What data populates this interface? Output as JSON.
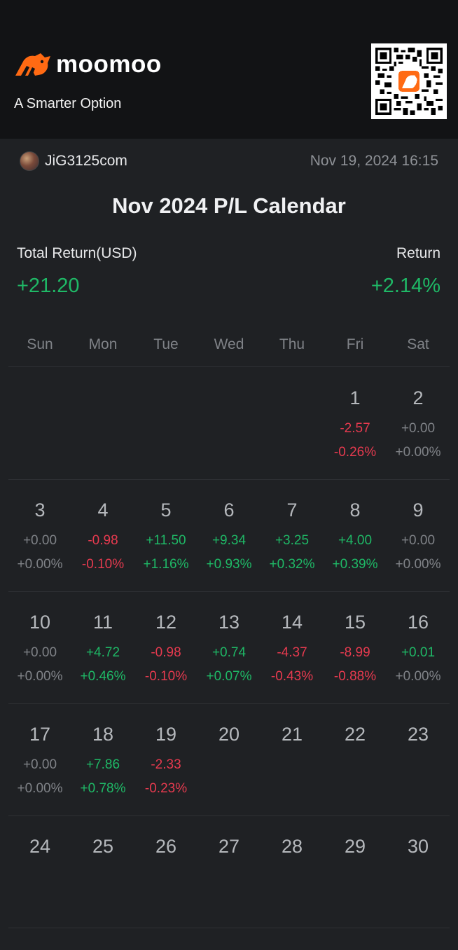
{
  "header": {
    "brand": "moomoo",
    "tagline": "A Smarter Option",
    "logo_icon": "moomoo-bull-logo",
    "qr_icon": "qr-code",
    "brand_color": "#ff6a13"
  },
  "user": {
    "name": "JiG3125com",
    "timestamp": "Nov 19, 2024 16:15"
  },
  "title": "Nov 2024 P/L Calendar",
  "summary": {
    "total_label": "Total Return(USD)",
    "total_value": "+21.20",
    "return_label": "Return",
    "return_value": "+2.14%"
  },
  "colors": {
    "positive": "#1fb866",
    "negative": "#e63a4f",
    "neutral": "#7f8287"
  },
  "weekdays": [
    "Sun",
    "Mon",
    "Tue",
    "Wed",
    "Thu",
    "Fri",
    "Sat"
  ],
  "weeks": [
    [
      {
        "day": "",
        "amount": "",
        "percent": ""
      },
      {
        "day": "",
        "amount": "",
        "percent": ""
      },
      {
        "day": "",
        "amount": "",
        "percent": ""
      },
      {
        "day": "",
        "amount": "",
        "percent": ""
      },
      {
        "day": "",
        "amount": "",
        "percent": ""
      },
      {
        "day": "1",
        "amount": "-2.57",
        "percent": "-0.26%"
      },
      {
        "day": "2",
        "amount": "+0.00",
        "percent": "+0.00%"
      }
    ],
    [
      {
        "day": "3",
        "amount": "+0.00",
        "percent": "+0.00%"
      },
      {
        "day": "4",
        "amount": "-0.98",
        "percent": "-0.10%"
      },
      {
        "day": "5",
        "amount": "+11.50",
        "percent": "+1.16%"
      },
      {
        "day": "6",
        "amount": "+9.34",
        "percent": "+0.93%"
      },
      {
        "day": "7",
        "amount": "+3.25",
        "percent": "+0.32%"
      },
      {
        "day": "8",
        "amount": "+4.00",
        "percent": "+0.39%"
      },
      {
        "day": "9",
        "amount": "+0.00",
        "percent": "+0.00%"
      }
    ],
    [
      {
        "day": "10",
        "amount": "+0.00",
        "percent": "+0.00%"
      },
      {
        "day": "11",
        "amount": "+4.72",
        "percent": "+0.46%"
      },
      {
        "day": "12",
        "amount": "-0.98",
        "percent": "-0.10%"
      },
      {
        "day": "13",
        "amount": "+0.74",
        "percent": "+0.07%"
      },
      {
        "day": "14",
        "amount": "-4.37",
        "percent": "-0.43%"
      },
      {
        "day": "15",
        "amount": "-8.99",
        "percent": "-0.88%"
      },
      {
        "day": "16",
        "amount": "+0.01",
        "percent": "+0.00%"
      }
    ],
    [
      {
        "day": "17",
        "amount": "+0.00",
        "percent": "+0.00%"
      },
      {
        "day": "18",
        "amount": "+7.86",
        "percent": "+0.78%"
      },
      {
        "day": "19",
        "amount": "-2.33",
        "percent": "-0.23%"
      },
      {
        "day": "20",
        "amount": "",
        "percent": ""
      },
      {
        "day": "21",
        "amount": "",
        "percent": ""
      },
      {
        "day": "22",
        "amount": "",
        "percent": ""
      },
      {
        "day": "23",
        "amount": "",
        "percent": ""
      }
    ],
    [
      {
        "day": "24",
        "amount": "",
        "percent": ""
      },
      {
        "day": "25",
        "amount": "",
        "percent": ""
      },
      {
        "day": "26",
        "amount": "",
        "percent": ""
      },
      {
        "day": "27",
        "amount": "",
        "percent": ""
      },
      {
        "day": "28",
        "amount": "",
        "percent": ""
      },
      {
        "day": "29",
        "amount": "",
        "percent": ""
      },
      {
        "day": "30",
        "amount": "",
        "percent": ""
      }
    ]
  ]
}
